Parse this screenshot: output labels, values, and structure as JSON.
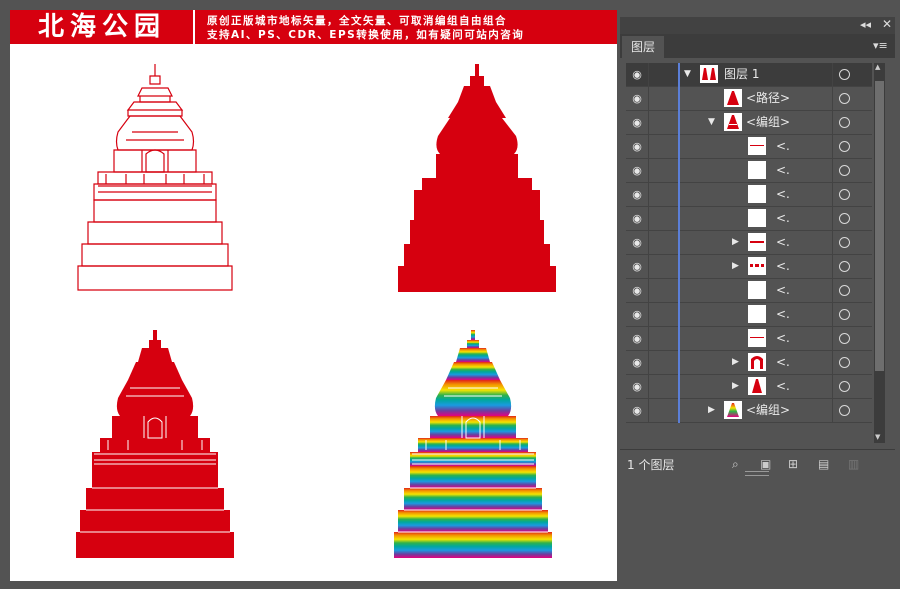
{
  "banner": {
    "title": "北海公园",
    "line1": "原创正版城市地标矢量，全文矢量、可取消编组自由组合",
    "line2": "支持AI、PS、CDR、EPS转换使用，如有疑问可站内咨询"
  },
  "colors": {
    "brand_red": "#d6000f",
    "panel_bg": "#535353",
    "selection_bar": "#5b7fd8"
  },
  "artwork": [
    "red-outline-stupa",
    "red-silhouette-stupa",
    "red-detailed-stupa",
    "rainbow-gradient-stupa"
  ],
  "panel": {
    "tab_label": "图层",
    "collapse_icon": "double-chevron-left-icon",
    "close_icon": "close-x-icon",
    "menu_icon": "panel-menu-icon",
    "layer_count": "1 个图层",
    "rows": [
      {
        "label": "图层 1",
        "expanded": true,
        "selected": true
      },
      {
        "label": "<路径>",
        "expanded": false,
        "selected": false
      },
      {
        "label": "<编组>",
        "expanded": true,
        "selected": false
      },
      {
        "label": "<.",
        "selected": false
      },
      {
        "label": "<.",
        "selected": false
      },
      {
        "label": "<.",
        "selected": false
      },
      {
        "label": "<.",
        "selected": false
      },
      {
        "label": "<.",
        "expandable": true,
        "selected": false
      },
      {
        "label": "<.",
        "expandable": true,
        "selected": false
      },
      {
        "label": "<.",
        "selected": false
      },
      {
        "label": "<.",
        "selected": false
      },
      {
        "label": "<.",
        "selected": false
      },
      {
        "label": "<.",
        "expandable": true,
        "selected": false
      },
      {
        "label": "<.",
        "expandable": true,
        "selected": false
      },
      {
        "label": "<编组>",
        "expanded": false,
        "selected": false
      }
    ],
    "bottom_icons": [
      "locate-object-icon",
      "make-clipping-mask-icon",
      "new-sublayer-icon",
      "new-layer-icon",
      "delete-icon"
    ]
  }
}
